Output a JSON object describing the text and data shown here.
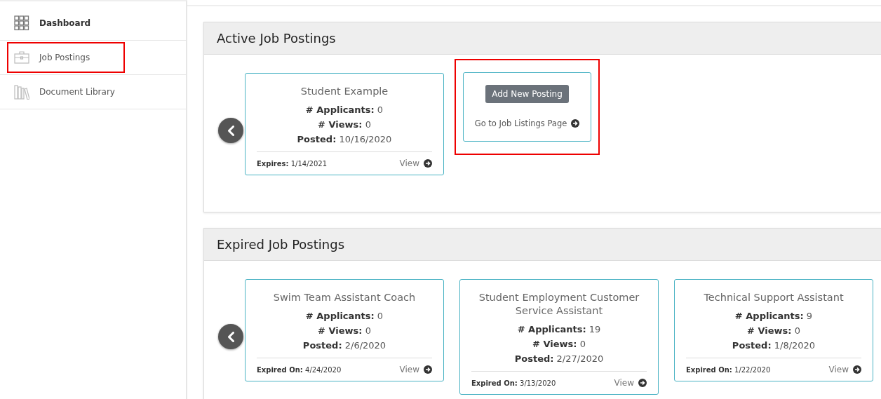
{
  "sidebar": {
    "items": [
      {
        "label": "Dashboard",
        "kind": "grid",
        "selected": true,
        "highlighted": false
      },
      {
        "label": "Job Postings",
        "kind": "briefcase",
        "selected": false,
        "highlighted": true
      },
      {
        "label": "Document Library",
        "kind": "books",
        "selected": false,
        "highlighted": false
      }
    ]
  },
  "sections": [
    {
      "title": "Active Job Postings",
      "cards": [
        {
          "kind": "posting",
          "title": "Student Example",
          "stats": [
            "**# Applicants:** 0",
            "**# Views:** 0",
            "**Posted:** 10/16/2020"
          ],
          "expiry": "**Expires:** 1/14/2021",
          "link": "View"
        },
        {
          "kind": "add",
          "button": "Add New Posting",
          "link": "Go to Job Listings Page",
          "highlighted": true
        }
      ]
    },
    {
      "title": "Expired Job Postings",
      "cards": [
        {
          "kind": "posting",
          "title": "Swim Team Assistant Coach",
          "stats": [
            "**# Applicants:** 0",
            "**# Views:** 0",
            "**Posted:** 2/6/2020"
          ],
          "expiry": "**Expired On:** 4/24/2020",
          "link": "View"
        },
        {
          "kind": "posting",
          "title": "Student Employment Customer Service Assistant",
          "stats": [
            "**# Applicants:** 19",
            "**# Views:** 0",
            "**Posted:** 2/27/2020"
          ],
          "expiry": "**Expired On:** 3/13/2020",
          "link": "View"
        },
        {
          "kind": "posting",
          "title": "Technical Support Assistant",
          "stats": [
            "**# Applicants:** 9",
            "**# Views:** 0",
            "**Posted:** 1/8/2020"
          ],
          "expiry": "**Expired On:** 1/22/2020",
          "link": "View"
        }
      ]
    }
  ]
}
